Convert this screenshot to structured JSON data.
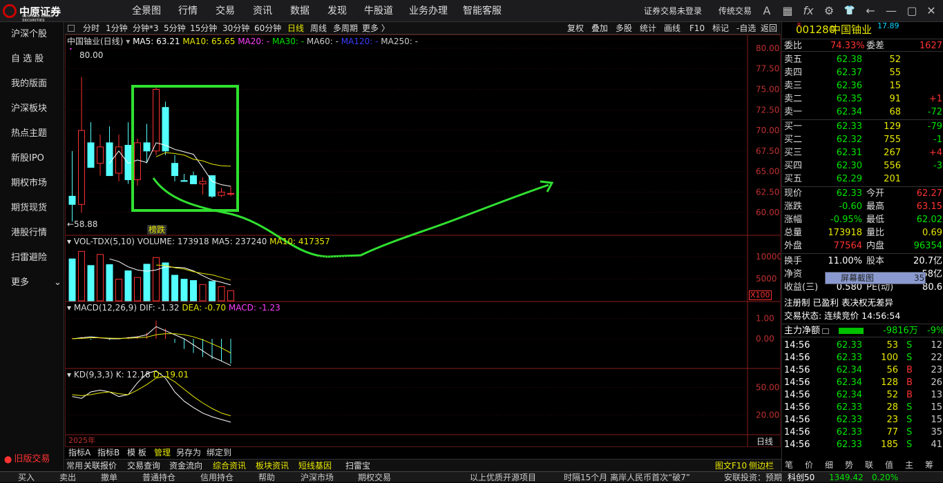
{
  "top": {
    "brand": "中原证券",
    "brand_en": "CENTRAL CHINA SECURITIES",
    "menu": [
      "全景图",
      "行情",
      "交易",
      "资讯",
      "数据",
      "发现",
      "牛股道",
      "业务办理",
      "智能客服"
    ],
    "login": "证券交易未登录",
    "mode": "传统交易",
    "icons": [
      "text-size-icon",
      "grid-icon",
      "fx-icon",
      "gear-icon",
      "shirt-icon",
      "back-icon",
      "minimize-icon",
      "maximize-icon",
      "close-icon"
    ],
    "icon_glyphs": [
      "A",
      "▦",
      "fx",
      "⚙",
      "👕",
      "←",
      "—",
      "▢",
      "✕"
    ]
  },
  "sidebar": {
    "items": [
      "沪深个股",
      "自 选 股",
      "我的版面",
      "沪深板块",
      "热点主题",
      "新股IPO",
      "期权市场",
      "期货现货",
      "港股行情",
      "扫雷避险",
      "更多"
    ],
    "legacy": "旧版交易"
  },
  "timeframes": [
    "分时",
    "1分钟",
    "分钟*3",
    "5分钟",
    "15分钟",
    "30分钟",
    "60分钟",
    "日线",
    "周线",
    "多周期",
    "更多 〉"
  ],
  "active_timeframe": "日线",
  "tools": [
    "复权",
    "叠加",
    "多股",
    "统计",
    "画线",
    "F10",
    "标记",
    "-自选",
    "返回"
  ],
  "main_ind": {
    "name": "中国铀业(日线)",
    "ma5": "MA5: 63.21",
    "ma10": "MA10: 65.65",
    "ma20": "MA20: -",
    "ma30": "MA30: -",
    "ma60": "MA60: -",
    "ma120": "MA120: -",
    "ma250": "MA250: -"
  },
  "high_label": "80.00",
  "low_label": "←58.88",
  "badge": "榜跌",
  "year": "2025年",
  "period": "日线",
  "vol_ind": {
    "name": "VOL-TDX(5,10)",
    "vol": "VOLUME: 173918",
    "ma5": "MA5: 237240",
    "ma10": "MA10: 417357",
    "unit": "X100"
  },
  "macd_ind": {
    "name": "MACD(12,26,9)",
    "dif": "DIF: -1.32",
    "dea": "DEA: -0.70",
    "macd": "MACD: -1.23"
  },
  "kd_ind": {
    "name": "KD(9,3,3)",
    "k": "K: 12.18",
    "d": "D: 19.01"
  },
  "axes": {
    "price": [
      "80.00",
      "77.50",
      "75.00",
      "72.50",
      "70.00",
      "67.50",
      "65.00",
      "62.50",
      "60.00"
    ],
    "vol": [
      "10000",
      "5000"
    ],
    "macd": [
      "1.00",
      "0.00"
    ],
    "kd": [
      "50.00",
      "20.00"
    ]
  },
  "chart_data": {
    "type": "candlestick",
    "title": "中国铀业(日线)",
    "candles": [
      [
        62.0,
        67.5,
        58.9,
        61.0
      ],
      [
        61.0,
        76.5,
        60.0,
        70.0
      ],
      [
        68.5,
        71.0,
        66.5,
        65.5
      ],
      [
        66.0,
        69.5,
        64.5,
        68.0
      ],
      [
        68.5,
        70.5,
        64.5,
        64.5
      ],
      [
        64.8,
        69.5,
        63.8,
        68.0
      ],
      [
        68.2,
        71.0,
        63.5,
        64.0
      ],
      [
        64.0,
        69.0,
        63.3,
        68.5
      ],
      [
        68.5,
        70.8,
        66.0,
        67.5
      ],
      [
        67.5,
        75.5,
        67.0,
        75.0
      ],
      [
        72.8,
        73.5,
        67.0,
        67.5
      ],
      [
        66.0,
        67.0,
        63.8,
        64.5
      ],
      [
        63.9,
        64.7,
        63.8,
        63.8
      ],
      [
        64.5,
        65.0,
        63.5,
        63.5
      ],
      [
        63.5,
        64.3,
        62.2,
        63.8
      ],
      [
        64.5,
        64.5,
        61.8,
        62.0
      ],
      [
        62.1,
        63.0,
        61.9,
        62.5
      ],
      [
        62.3,
        63.2,
        62.0,
        62.33
      ]
    ],
    "volumes": [
      9500,
      11200,
      8000,
      10500,
      8200,
      4900,
      6800,
      5300,
      8300,
      9800,
      8600,
      5800,
      4900,
      4600,
      3700,
      4400,
      3200,
      2300
    ],
    "ma5": [
      null,
      null,
      null,
      null,
      66.0,
      67.5,
      66.0,
      66.4,
      66.1,
      68.5,
      68.2,
      67.7,
      67.4,
      67.1,
      65.5,
      63.8,
      63.4,
      63.2
    ],
    "ma10": [
      null,
      null,
      null,
      null,
      null,
      null,
      null,
      null,
      null,
      66.8,
      67.3,
      67.2,
      67.0,
      66.5,
      66.3,
      65.9,
      65.7,
      65.65
    ],
    "vol_ma5": [
      null,
      null,
      null,
      null,
      9500,
      8900,
      7700,
      7000,
      6700,
      7000,
      7700,
      7600,
      7500,
      6800,
      5700,
      4700,
      4200,
      3600
    ],
    "vol_ma10": [
      null,
      null,
      null,
      null,
      null,
      null,
      null,
      null,
      null,
      8100,
      8000,
      7500,
      7200,
      6600,
      6200,
      5900,
      5300,
      4700
    ],
    "macd": [
      0.05,
      0.1,
      -0.05,
      0.05,
      -0.05,
      0.05,
      0.1,
      0.15,
      0.3,
      0.9,
      0.5,
      -0.2,
      -0.5,
      -0.7,
      -0.9,
      -1.0,
      -1.1,
      -1.23
    ],
    "dif": [
      0.0,
      0.05,
      0.1,
      0.05,
      0.0,
      0.0,
      0.05,
      0.1,
      0.2,
      0.6,
      0.4,
      0.2,
      0.0,
      -0.3,
      -0.6,
      -0.9,
      -1.1,
      -1.32
    ],
    "dea": [
      0.0,
      0.02,
      0.05,
      0.05,
      0.03,
      0.02,
      0.03,
      0.05,
      0.08,
      0.2,
      0.25,
      0.25,
      0.2,
      0.1,
      -0.05,
      -0.25,
      -0.45,
      -0.7
    ],
    "k": [
      40,
      38,
      45,
      47,
      45,
      40,
      42,
      55,
      65,
      68,
      60,
      45,
      35,
      28,
      22,
      18,
      15,
      12.18
    ],
    "d": [
      42,
      41,
      42,
      44,
      45,
      43,
      42,
      47,
      53,
      60,
      62,
      56,
      48,
      40,
      33,
      27,
      22,
      19.01
    ],
    "price_range": [
      58,
      81
    ],
    "vol_range": [
      0,
      12500
    ],
    "macd_range": [
      -1.4,
      1.4
    ],
    "kd_range": [
      0,
      60
    ]
  },
  "right": {
    "code": "001280",
    "name": "中国铀业",
    "price_tag": "17.89",
    "weibi_label": "委比",
    "weibi": "74.33%",
    "weicha_label": "委差",
    "weicha": "1627",
    "asks": [
      [
        "卖五",
        "62.38",
        "52",
        ""
      ],
      [
        "卖四",
        "62.37",
        "55",
        ""
      ],
      [
        "卖三",
        "62.36",
        "15",
        ""
      ],
      [
        "卖二",
        "62.35",
        "91",
        "+1"
      ],
      [
        "卖一",
        "62.34",
        "68",
        "-72"
      ]
    ],
    "bids": [
      [
        "买一",
        "62.33",
        "129",
        "-79"
      ],
      [
        "买二",
        "62.32",
        "755",
        "-1"
      ],
      [
        "买三",
        "62.31",
        "267",
        "+4"
      ],
      [
        "买四",
        "62.30",
        "556",
        "-3"
      ],
      [
        "买五",
        "62.29",
        "201",
        ""
      ]
    ],
    "stats": [
      [
        "现价",
        "62.33",
        "今开",
        "62.27"
      ],
      [
        "涨跌",
        "-0.60",
        "最高",
        "63.15"
      ],
      [
        "涨幅",
        "-0.95%",
        "最低",
        "62.02"
      ],
      [
        "总量",
        "173918",
        "量比",
        "0.69"
      ],
      [
        "外盘",
        "77564",
        "内盘",
        "96354"
      ]
    ],
    "turn": [
      [
        "换手",
        "11.00%",
        "股本",
        "20.7亿"
      ],
      [
        "净资",
        "",
        "",
        "58亿"
      ],
      [
        "收益(三)",
        "0.580",
        "PE(动)",
        "80.6"
      ]
    ],
    "screenshot_tip": "屏幕截图",
    "tip_val": "35",
    "reg": "注册制 已盈利 表决权无差异",
    "trade_state": "交易状态: 连续竞价 14:56:54",
    "main_flow_label": "主力净额",
    "main_flow": "-9816万",
    "main_flow_pct": "-9%",
    "ticks": [
      [
        "14:56",
        "62.33",
        "53",
        "S",
        "12"
      ],
      [
        "14:56",
        "62.33",
        "100",
        "S",
        "22"
      ],
      [
        "14:56",
        "62.34",
        "56",
        "B",
        "23"
      ],
      [
        "14:56",
        "62.34",
        "128",
        "B",
        "26"
      ],
      [
        "14:56",
        "62.34",
        "52",
        "B",
        "13"
      ],
      [
        "14:56",
        "62.33",
        "28",
        "S",
        "15"
      ],
      [
        "14:56",
        "62.33",
        "23",
        "S",
        "15"
      ],
      [
        "14:56",
        "62.33",
        "77",
        "S",
        "35"
      ],
      [
        "14:56",
        "62.33",
        "185",
        "S",
        "41"
      ]
    ]
  },
  "tags": [
    "指标A",
    "指标B",
    "模 板",
    "管理",
    "另存为",
    "绑定到"
  ],
  "bottom": [
    "常用",
    "关联报价",
    "交易查询",
    "资金流向",
    "综合资讯",
    "板块资讯",
    "短线基因",
    "扫雷宝"
  ],
  "bottom_right": [
    "图文F10",
    "侧边栏"
  ],
  "right_tabs": [
    "笔",
    "价",
    "细",
    "势",
    "联",
    "值",
    "主",
    "筹"
  ],
  "status": [
    "买入",
    "卖出",
    "撤单",
    "普通持仓",
    "信用持仓",
    "帮助",
    "沪深市场",
    "期权交易",
    "以上优质开源项目",
    "时隔15个月 离岸人民币首次“破7”",
    "安联投资：预期"
  ],
  "index": {
    "name": "科创50",
    "val": "1349.42",
    "chg": "0.20%"
  }
}
